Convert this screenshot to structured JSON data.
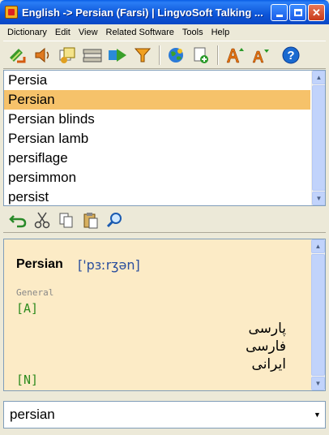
{
  "window": {
    "title": "English -> Persian (Farsi) | LingvoSoft Talking ...",
    "colors": {
      "titlebar": "#0a55d8",
      "selection": "#f6c26a",
      "pane": "#fcebc6"
    }
  },
  "menu": {
    "items": [
      "Dictionary",
      "Edit",
      "View",
      "Related Software",
      "Tools",
      "Help"
    ]
  },
  "toolbar": {
    "icons": [
      "swap-direction-icon",
      "speaker-icon",
      "flashcards-icon",
      "dictionary-books-icon",
      "play-arrow-icon",
      "filter-icon",
      "globe-icon",
      "add-word-icon",
      "increase-font-icon",
      "decrease-font-icon",
      "help-icon"
    ],
    "help_glyph": "?"
  },
  "wordlist": {
    "items": [
      "Persia",
      "Persian",
      "Persian blinds",
      "Persian lamb",
      "persiflage",
      "persimmon",
      "persist"
    ],
    "selected_index": 1
  },
  "edit_toolbar": {
    "icons": [
      "undo-icon",
      "cut-icon",
      "copy-icon",
      "paste-icon",
      "search-icon"
    ]
  },
  "translation": {
    "headword": "Persian",
    "transcription": "['pɜːrʒən]",
    "section": "General",
    "entries": [
      {
        "pos": "[A]",
        "translations": [
          "پارسی",
          "فارسی",
          "ایرانی"
        ]
      },
      {
        "pos": "[N]",
        "translations": []
      }
    ]
  },
  "search": {
    "value": "persian"
  }
}
